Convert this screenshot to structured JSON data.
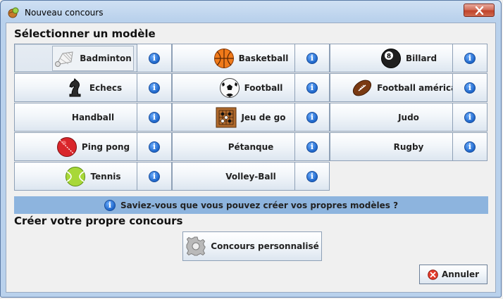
{
  "window": {
    "title": "Nouveau concours",
    "title_icon": "trophy-ball-icon",
    "close_icon": "close-icon"
  },
  "models": {
    "heading": "Sélectionner un modèle",
    "items": [
      {
        "label": "Badminton",
        "icon": "shuttlecock-icon"
      },
      {
        "label": "Basketball",
        "icon": "basketball-icon"
      },
      {
        "label": "Billard",
        "icon": "billiard-ball-icon"
      },
      {
        "label": "Echecs",
        "icon": "chess-knight-icon"
      },
      {
        "label": "Football",
        "icon": "soccer-ball-icon"
      },
      {
        "label": "Football américain",
        "icon": "american-football-icon"
      },
      {
        "label": "Handball",
        "icon": ""
      },
      {
        "label": "Jeu de go",
        "icon": "go-board-icon"
      },
      {
        "label": "Judo",
        "icon": ""
      },
      {
        "label": "Ping pong",
        "icon": "cricket-ball-icon"
      },
      {
        "label": "Pétanque",
        "icon": ""
      },
      {
        "label": "Rugby",
        "icon": ""
      },
      {
        "label": "Tennis",
        "icon": "tennis-ball-icon"
      },
      {
        "label": "Volley-Ball",
        "icon": ""
      }
    ],
    "info_icon": "info-icon",
    "info_glyph": "i"
  },
  "banner": {
    "text": "Saviez-vous que vous pouvez créer vos propres modèles ?",
    "icon": "info-icon"
  },
  "custom": {
    "heading": "Créer votre propre concours",
    "button_label": "Concours personnalisé",
    "icon": "gear-icon"
  },
  "footer": {
    "cancel_label": "Annuler",
    "cancel_icon": "cancel-icon"
  },
  "colors": {
    "banner": "#8db4de",
    "info": "#1c64c8",
    "close": "#c0432a"
  }
}
